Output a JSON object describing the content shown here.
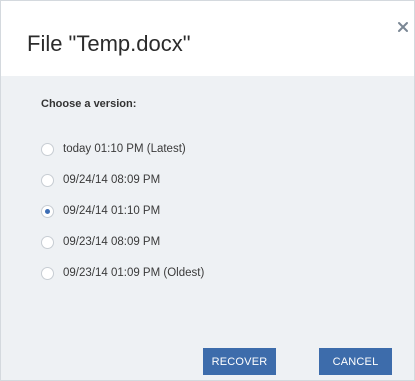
{
  "dialog": {
    "title": "File \"Temp.docx\"",
    "close_icon": "close-icon",
    "section_label": "Choose a version:",
    "versions": [
      {
        "label": "today 01:10 PM (Latest)",
        "selected": false
      },
      {
        "label": "09/24/14 08:09 PM",
        "selected": false
      },
      {
        "label": "09/24/14 01:10 PM",
        "selected": true
      },
      {
        "label": "09/23/14 08:09 PM",
        "selected": false
      },
      {
        "label": "09/23/14 01:09 PM (Oldest)",
        "selected": false
      }
    ],
    "buttons": {
      "recover_label": "RECOVER",
      "cancel_label": "CANCEL"
    }
  },
  "colors": {
    "accent": "#3d6cab",
    "radio_dot": "#3d6eb5",
    "body_background": "#eef1f4",
    "header_background": "#ffffff"
  }
}
